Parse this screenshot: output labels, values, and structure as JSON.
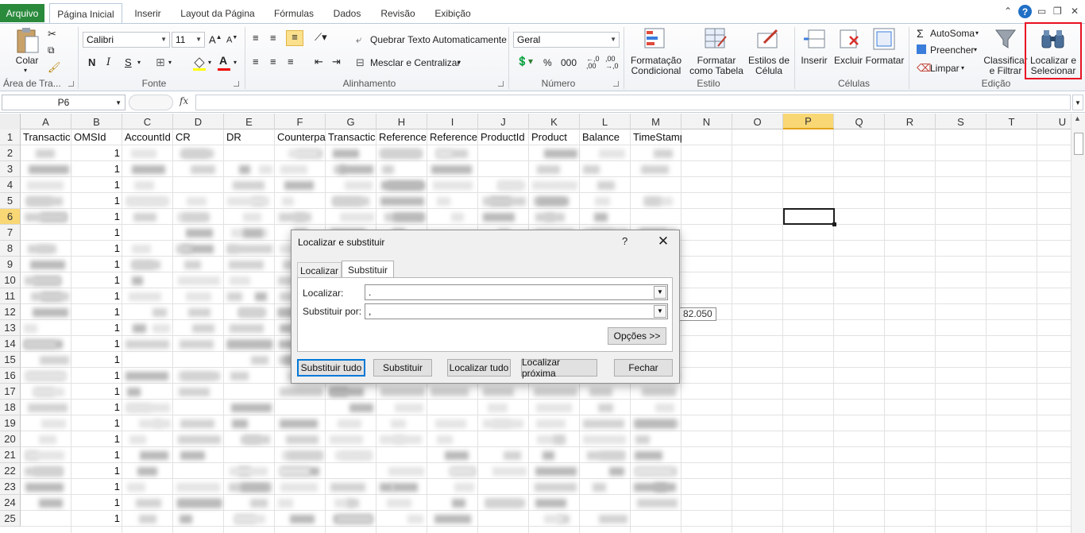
{
  "ribbon_tabs": {
    "file": "Arquivo",
    "tabs": [
      "Página Inicial",
      "Inserir",
      "Layout da Página",
      "Fórmulas",
      "Dados",
      "Revisão",
      "Exibição"
    ],
    "active": "Página Inicial"
  },
  "clipboard": {
    "paste": "Colar",
    "group": "Área de Tra..."
  },
  "font": {
    "name": "Calibri",
    "size": "11",
    "group": "Fonte",
    "bold": "N",
    "italic": "I",
    "underline": "S"
  },
  "alignment": {
    "wrap": "Quebrar Texto Automaticamente",
    "merge": "Mesclar e Centralizar",
    "group": "Alinhamento"
  },
  "number": {
    "format": "Geral",
    "percent": "%",
    "thousands": "000",
    "group": "Número"
  },
  "styles": {
    "conditional_1": "Formatação",
    "conditional_2": "Condicional",
    "table_1": "Formatar",
    "table_2": "como Tabela",
    "cell_1": "Estilos de",
    "cell_2": "Célula",
    "group": "Estilo"
  },
  "cells": {
    "insert": "Inserir",
    "delete": "Excluir",
    "format": "Formatar",
    "group": "Células"
  },
  "editing": {
    "autosum": "AutoSoma",
    "fill": "Preencher",
    "clear": "Limpar",
    "sort_1": "Classificar",
    "sort_2": "e Filtrar",
    "find_1": "Localizar e",
    "find_2": "Selecionar",
    "group": "Edição"
  },
  "formula_bar": {
    "name_box": "P6",
    "fx": "fx",
    "value": ""
  },
  "columns": [
    "A",
    "B",
    "C",
    "D",
    "E",
    "F",
    "G",
    "H",
    "I",
    "J",
    "K",
    "L",
    "M",
    "N",
    "O",
    "P",
    "Q",
    "R",
    "S",
    "T",
    "U"
  ],
  "selected_column": "P",
  "rows": [
    "1",
    "2",
    "3",
    "4",
    "5",
    "6",
    "7",
    "8",
    "9",
    "10",
    "11",
    "12",
    "13",
    "14",
    "15",
    "16",
    "17",
    "18",
    "19",
    "20",
    "21",
    "22",
    "23",
    "24",
    "25"
  ],
  "selected_row": "6",
  "headers": [
    "Transactic",
    "OMSId",
    "AccountId",
    "CR",
    "DR",
    "Counterpa",
    "Transactic",
    "Reference",
    "Reference",
    "ProductId",
    "Product",
    "Balance",
    "TimeStamp"
  ],
  "omsid_values": [
    "1",
    "1",
    "1",
    "1",
    "1",
    "1",
    "1",
    "1",
    "1",
    "1",
    "1",
    "1",
    "1",
    "1",
    "1",
    "1",
    "1",
    "1",
    "1",
    "1",
    "1",
    "1",
    "1",
    "1"
  ],
  "tooltip": "82.050",
  "dialog": {
    "title": "Localizar e substituir",
    "help": "?",
    "close": "✕",
    "tab_find": "Localizar",
    "tab_replace": "Substituir",
    "find_label": "Localizar:",
    "find_value": ".",
    "replace_label": "Substituir por:",
    "replace_value": ",",
    "options": "Opções >>",
    "replace_all": "Substituir tudo",
    "replace": "Substituir",
    "find_all": "Localizar tudo",
    "find_next": "Localizar próxima",
    "close_button": "Fechar"
  }
}
